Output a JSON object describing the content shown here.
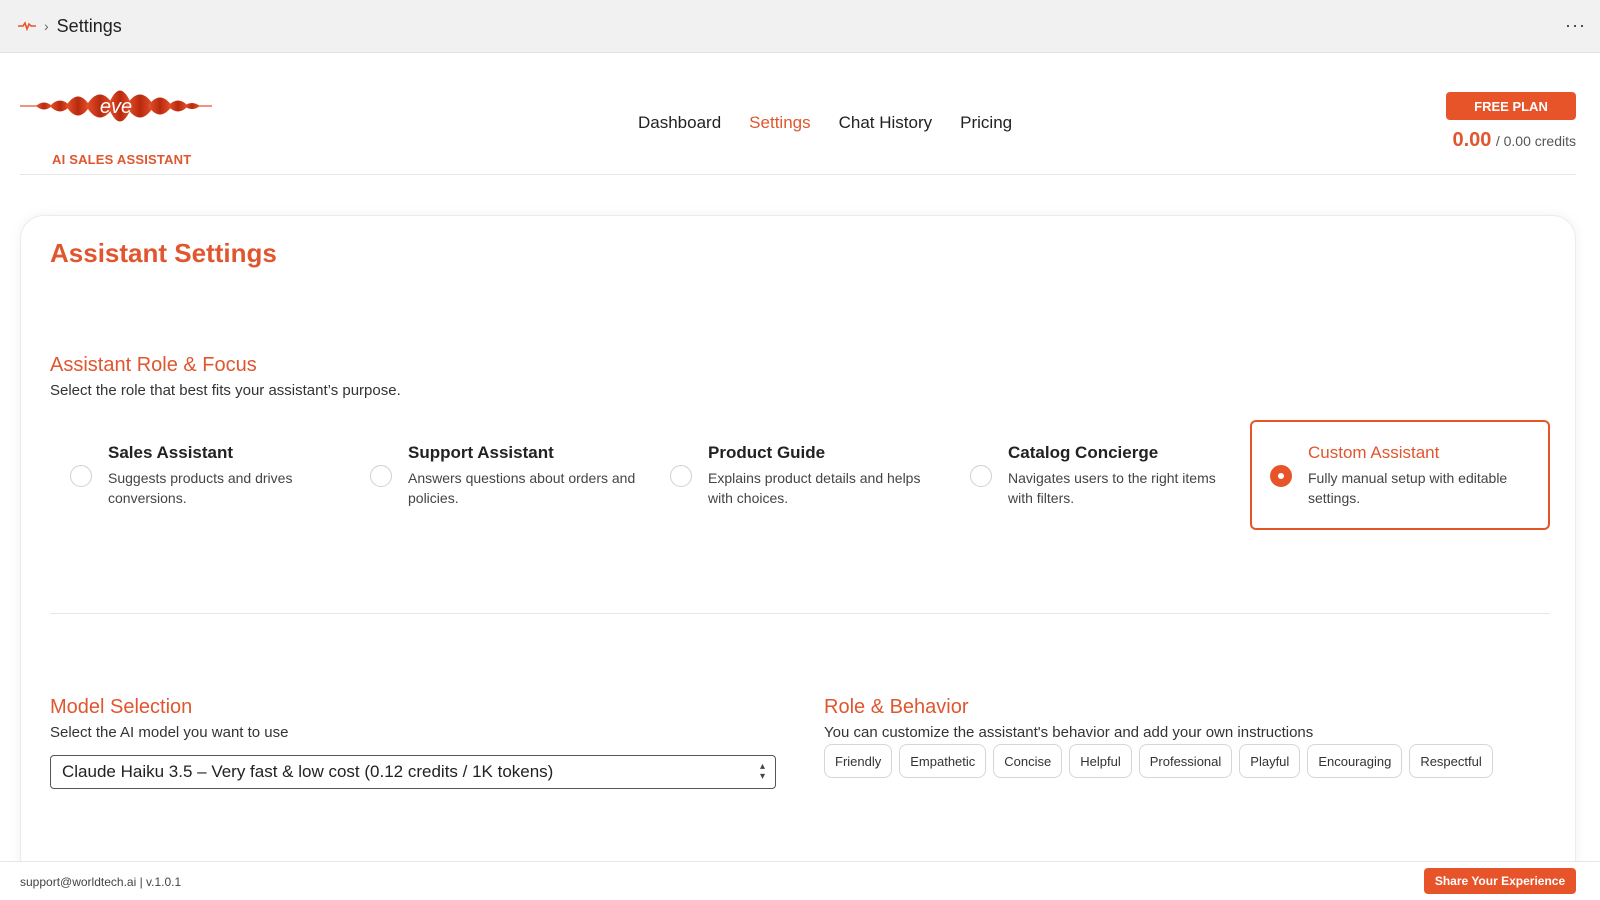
{
  "topbar": {
    "title": "Settings",
    "separator": "›",
    "more_label": "···",
    "logo_icon": "eve-wave-icon"
  },
  "header": {
    "logo_text": "eve",
    "logo_tagline": "AI SALES ASSISTANT",
    "nav": [
      {
        "label": "Dashboard",
        "active": false
      },
      {
        "label": "Settings",
        "active": true
      },
      {
        "label": "Chat History",
        "active": false
      },
      {
        "label": "Pricing",
        "active": false
      }
    ],
    "plan_label": "FREE PLAN",
    "credits_used": "0.00",
    "credits_total": "/ 0.00 credits"
  },
  "settings": {
    "title": "Assistant Settings",
    "role": {
      "title": "Assistant Role & Focus",
      "subtitle": "Select the role that best fits your assistant’s purpose.",
      "options": [
        {
          "title": "Sales Assistant",
          "desc": "Suggests products and drives conversions.",
          "selected": false
        },
        {
          "title": "Support Assistant",
          "desc": "Answers questions about orders and policies.",
          "selected": false
        },
        {
          "title": "Product Guide",
          "desc": "Explains product details and helps with choices.",
          "selected": false
        },
        {
          "title": "Catalog Concierge",
          "desc": "Navigates users to the right items with filters.",
          "selected": false
        },
        {
          "title": "Custom Assistant",
          "desc": "Fully manual setup with editable settings.",
          "selected": true
        }
      ]
    },
    "model": {
      "title": "Model Selection",
      "subtitle": "Select the AI model you want to use",
      "selected": "Claude Haiku 3.5 – Very fast & low cost (0.12 credits / 1K tokens)"
    },
    "behavior": {
      "title": "Role & Behavior",
      "subtitle": "You can customize the assistant's behavior and add your own instructions",
      "tones": [
        "Friendly",
        "Empathetic",
        "Concise",
        "Helpful",
        "Professional",
        "Playful",
        "Encouraging",
        "Respectful"
      ]
    }
  },
  "footer": {
    "support": "support@worldtech.ai | v.1.0.1",
    "share_label": "Share Your Experience"
  },
  "colors": {
    "accent": "#e8542a",
    "accent_text": "#e0562f",
    "logo_dark": "#b8290f"
  }
}
